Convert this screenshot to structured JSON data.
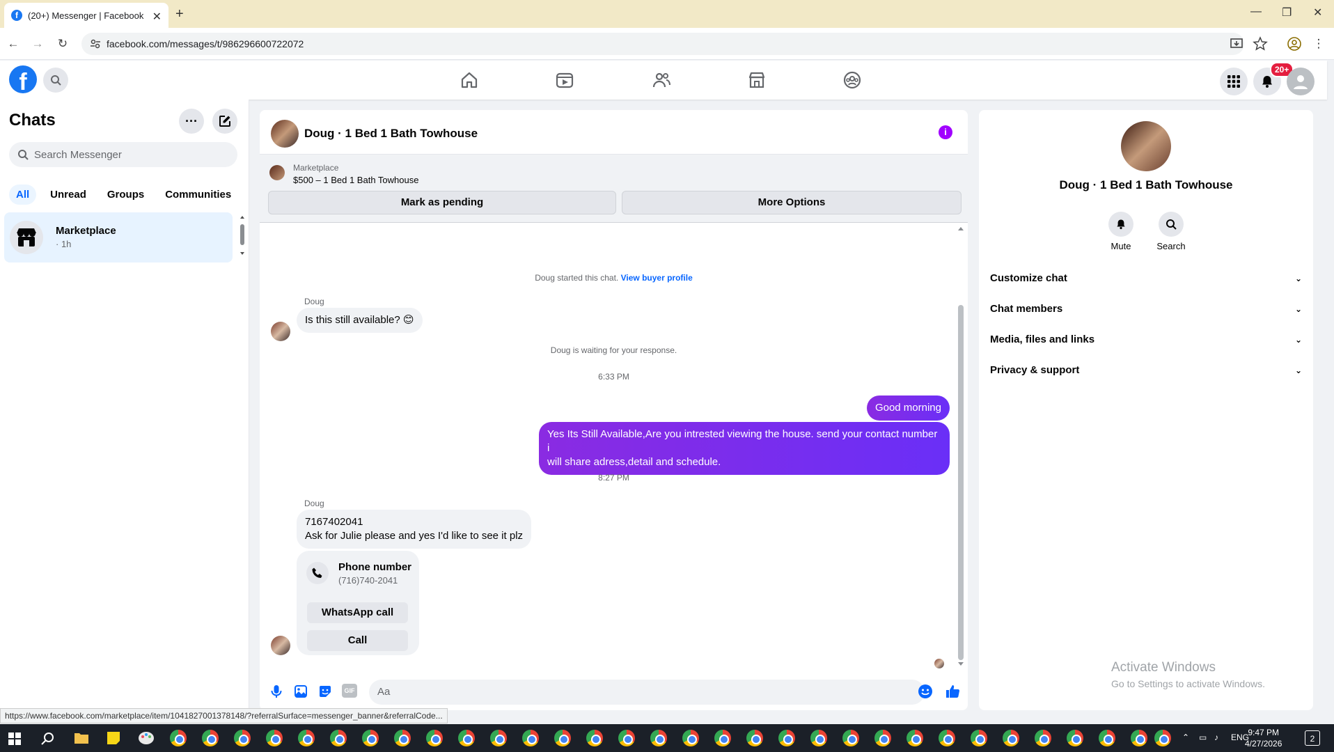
{
  "browser": {
    "tab_title": "(20+) Messenger | Facebook",
    "tab_favicon": "f",
    "url": "facebook.com/messages/t/986296600722072",
    "status_url": "https://www.facebook.com/marketplace/item/1041827001378148/?referralSurface=messenger_banner&referralCode..."
  },
  "header": {
    "logo": "f",
    "notification_badge": "20+"
  },
  "chats": {
    "title": "Chats",
    "search_placeholder": "Search Messenger",
    "filters": [
      "All",
      "Unread",
      "Groups",
      "Communities"
    ],
    "items": [
      {
        "name": "Marketplace",
        "time": "· 1h"
      }
    ]
  },
  "conversation": {
    "name": "Doug · 1 Bed 1 Bath Towhouse",
    "info_glyph": "i",
    "banner": {
      "label": "Marketplace",
      "title": "$500 – 1 Bed 1 Bath Towhouse",
      "pending_button": "Mark as pending",
      "options_button": "More Options"
    },
    "started_text": "Doug started this chat.",
    "buyer_profile_link": "View buyer profile",
    "sender1": "Doug",
    "msg1": "Is this still available? 😊",
    "waiting_text": "Doug is waiting for your response.",
    "time1": "6:33 PM",
    "out1": "Good morning",
    "out2_line1": "Yes Its Still Available,Are you intrested viewing the house. send your contact number i",
    "out2_line2": "will share adress,detail and schedule.",
    "time2": "8:27 PM",
    "sender2": "Doug",
    "msg2_line1": "7167402041",
    "msg2_line2": "Ask for Julie please and yes I'd like to see it plz",
    "phone_card": {
      "title": "Phone number",
      "number": "(716)740-2041",
      "whatsapp_button": "WhatsApp call",
      "call_button": "Call"
    },
    "composer_placeholder": "Aa",
    "gif_label": "GIF"
  },
  "info_panel": {
    "name": "Doug · 1 Bed 1 Bath Towhouse",
    "mute_label": "Mute",
    "search_label": "Search",
    "sections": [
      "Customize chat",
      "Chat members",
      "Media, files and links",
      "Privacy & support"
    ]
  },
  "watermark": {
    "line1": "Activate Windows",
    "line2": "Go to Settings to activate Windows."
  },
  "taskbar": {
    "lang": "ENG",
    "time": "9:47 PM",
    "date": "4/27/2026",
    "notif_count": "2"
  },
  "colors": {
    "accent": "#0866ff",
    "brand": "#1877f2",
    "outgoing": "#7b2ff7",
    "badge": "#e41e3f"
  }
}
